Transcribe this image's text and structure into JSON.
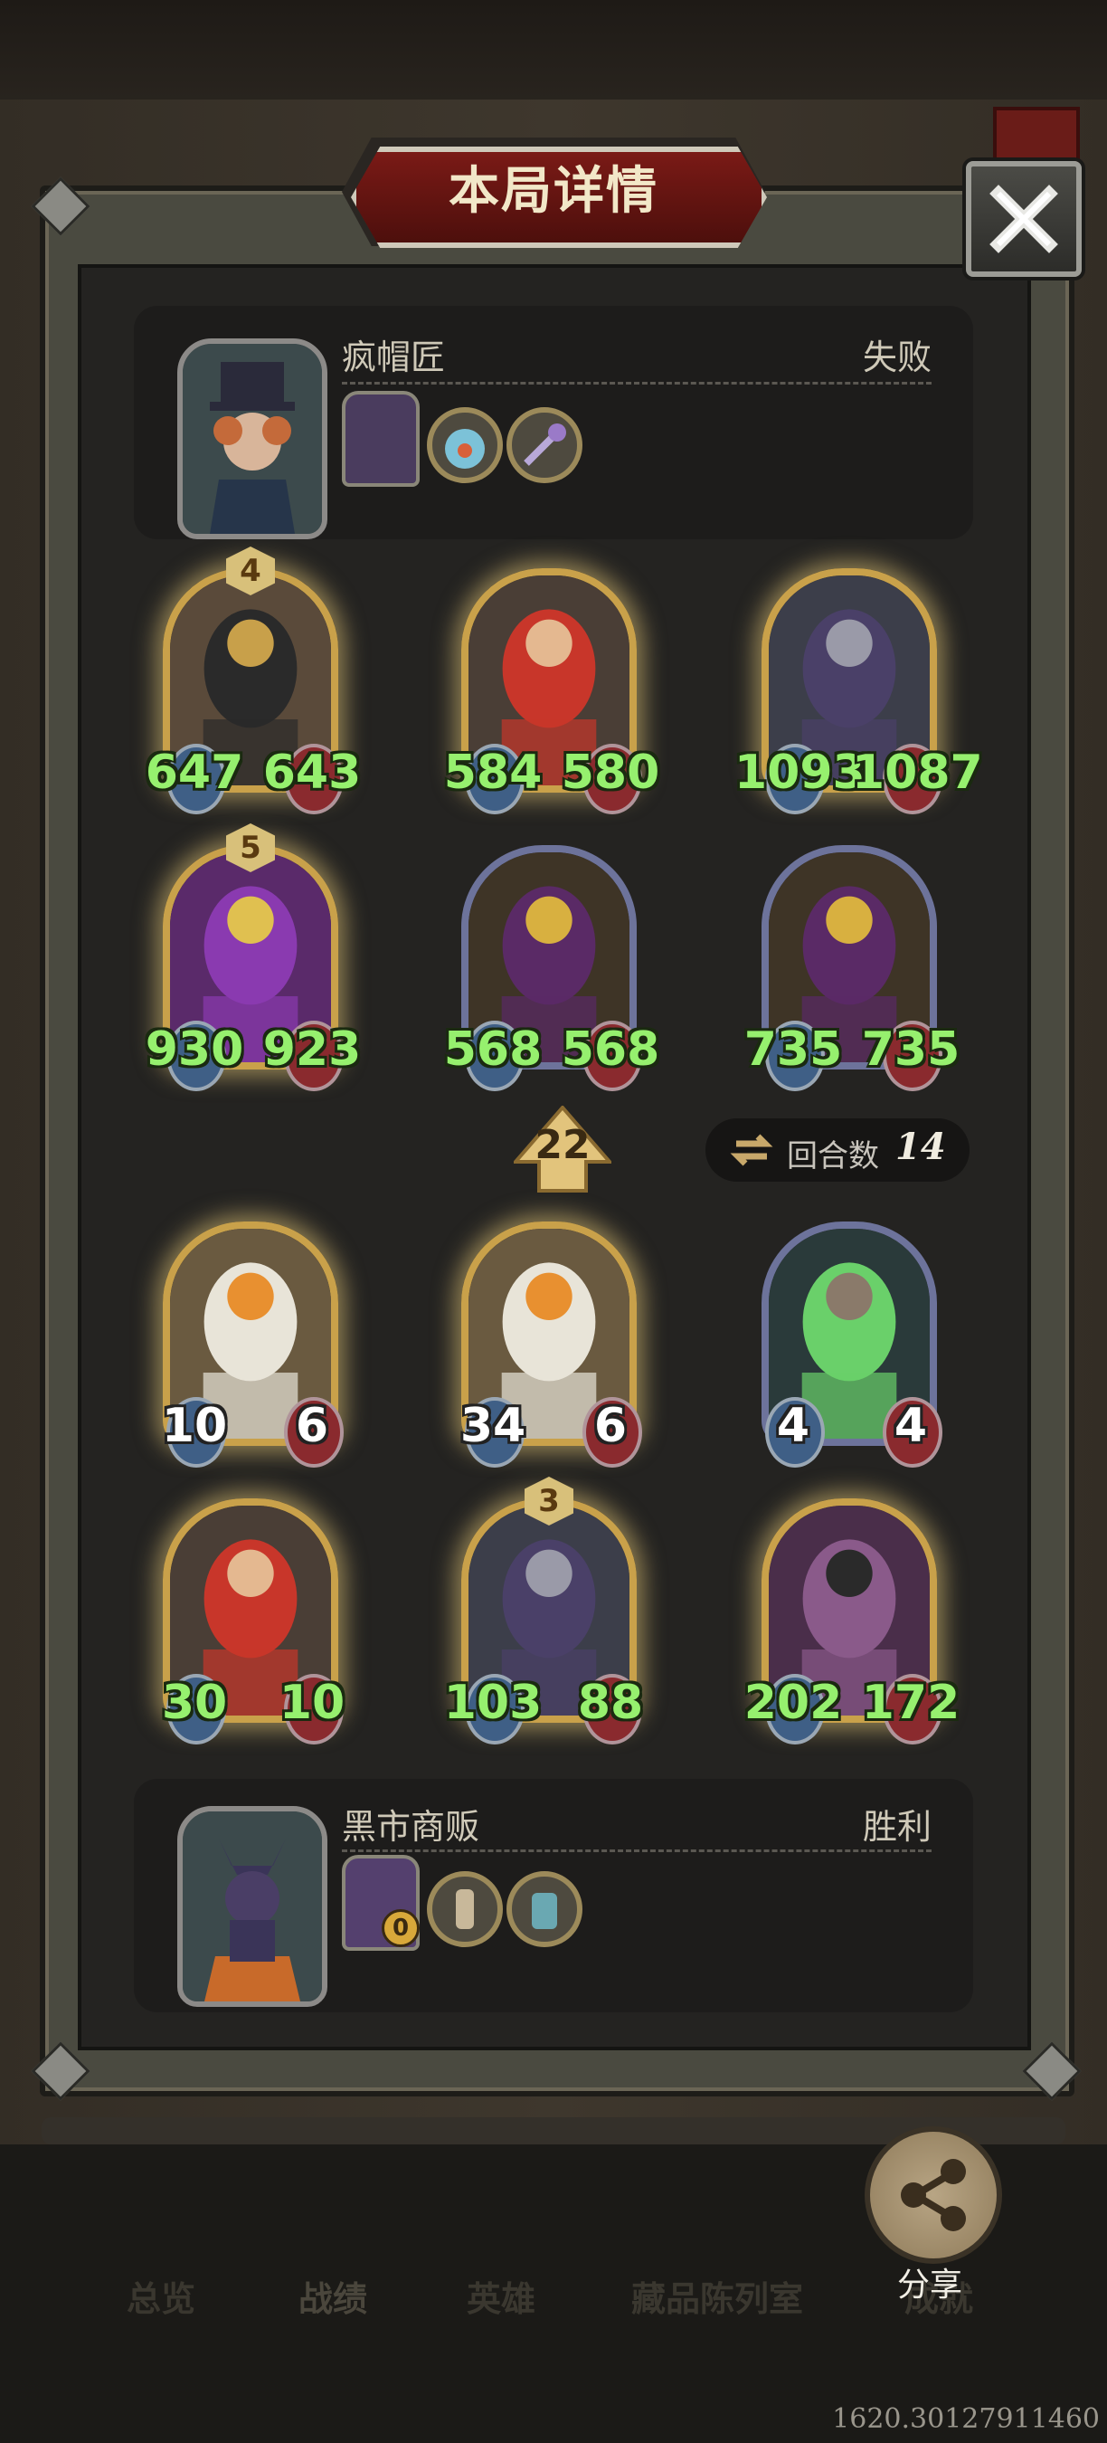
{
  "window": {
    "title": "本局详情"
  },
  "opponent": {
    "name": "疯帽匠",
    "result": "失败",
    "items": [
      "hat-relic-icon",
      "fishbowl-icon",
      "key-wand-icon"
    ]
  },
  "player": {
    "name": "黑市商贩",
    "result": "胜利",
    "items": [
      "door-relic-icon",
      "scroll-icon",
      "jar-icon"
    ],
    "door_counter": "0"
  },
  "opponent_board": [
    {
      "attack": "647",
      "health": "643",
      "level": "4",
      "frame": "gold",
      "art": "shield-knight"
    },
    {
      "attack": "584",
      "health": "580",
      "frame": "gold",
      "art": "pirate-woman"
    },
    {
      "attack": "1093",
      "health": "1087",
      "frame": "gold",
      "art": "plague-swordsman"
    },
    {
      "attack": "930",
      "health": "923",
      "level": "5",
      "frame": "gold",
      "art": "purple-creature"
    },
    {
      "attack": "568",
      "health": "568",
      "frame": "silver",
      "art": "book-golem"
    },
    {
      "attack": "735",
      "health": "735",
      "frame": "silver",
      "art": "book-golem"
    }
  ],
  "player_board": [
    {
      "attack": "10",
      "health": "6",
      "frame": "gold",
      "art": "pelican"
    },
    {
      "attack": "34",
      "health": "6",
      "frame": "gold",
      "art": "pelican"
    },
    {
      "attack": "4",
      "health": "4",
      "frame": "silver",
      "art": "snake-ghost"
    },
    {
      "attack": "30",
      "health": "10",
      "frame": "gold",
      "art": "pirate-woman"
    },
    {
      "attack": "103",
      "health": "88",
      "level": "3",
      "frame": "gold",
      "art": "plague-swordsman"
    },
    {
      "attack": "202",
      "health": "172",
      "frame": "gold",
      "art": "octopus-captain"
    }
  ],
  "tier": {
    "value": "22"
  },
  "rounds": {
    "label": "回合数",
    "value": "14"
  },
  "nav": {
    "tabs": [
      "总览",
      "战绩",
      "英雄",
      "藏品陈列室",
      "成就"
    ],
    "share_label": "分享"
  },
  "footer": {
    "code": "1620.30127911460"
  },
  "colors": {
    "gold_frame": "#c9a14a",
    "silver_frame": "#6d739b",
    "stat_green": "#96f06e",
    "banner_red": "#7a1a16"
  }
}
